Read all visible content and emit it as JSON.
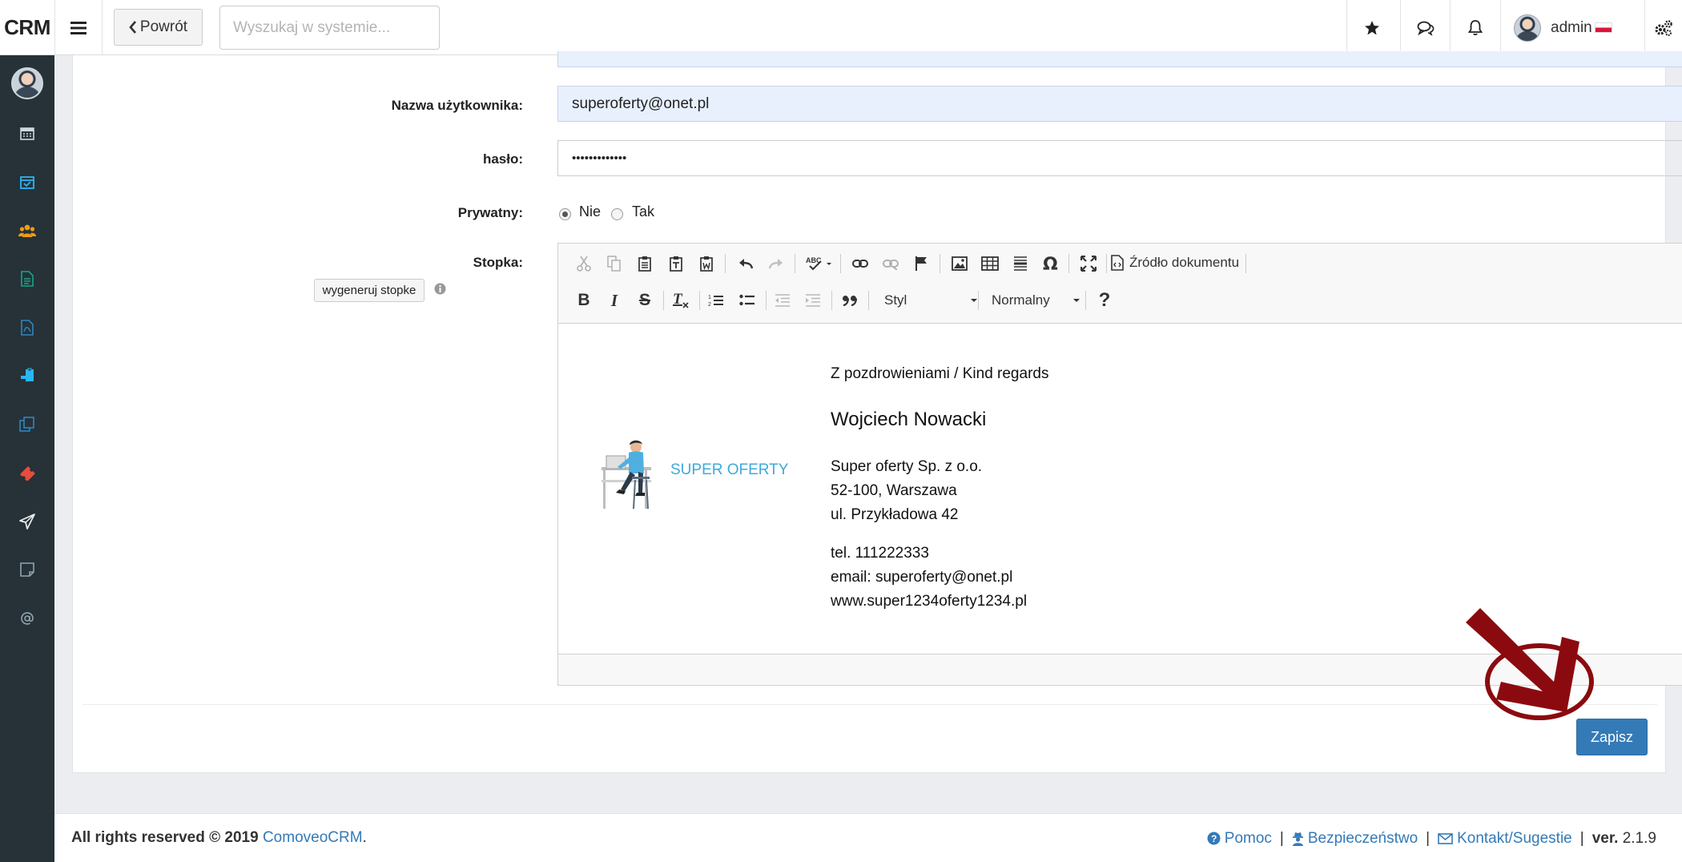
{
  "app": {
    "logo": "CRM"
  },
  "header": {
    "back_label": "Powrót",
    "search_placeholder": "Wyszukaj w systemie...",
    "user_name": "admin"
  },
  "form": {
    "username_label": "Nazwa użytkownika:",
    "username_value": "superoferty@onet.pl",
    "password_label": "hasło:",
    "password_value": "•••••••••••••",
    "private_label": "Prywatny:",
    "private_no": "Nie",
    "private_yes": "Tak",
    "footer_label": "Stopka:",
    "generate_button": "wygeneruj stopke",
    "save_button": "Zapisz"
  },
  "editor": {
    "source_label": "Źródło dokumentu",
    "style_combo": "Styl",
    "format_combo": "Normalny",
    "help": "?"
  },
  "signature": {
    "greeting": "Z pozdrowieniami / Kind regards",
    "name": "Wojciech Nowacki",
    "company": "Super oferty Sp. z o.o.",
    "postal": "52-100, Warszawa",
    "street": "ul. Przykładowa 42",
    "phone": "tel. 111222333",
    "email": "email: superoferty@onet.pl",
    "website": "www.super1234oferty1234.pl",
    "brand": "SUPER OFERTY"
  },
  "footer": {
    "rights": "All rights reserved © 2019",
    "company_link": "ComoveoCRM",
    "help": "Pomoc",
    "security": "Bezpieczeństwo",
    "contact": "Kontakt/Sugestie",
    "version_label": "ver.",
    "version": "2.1.9"
  },
  "colors": {
    "sidebar": "#263238",
    "primary": "#337ab7",
    "annotation": "#8b0a0f",
    "brand": "#3fa9d9"
  }
}
